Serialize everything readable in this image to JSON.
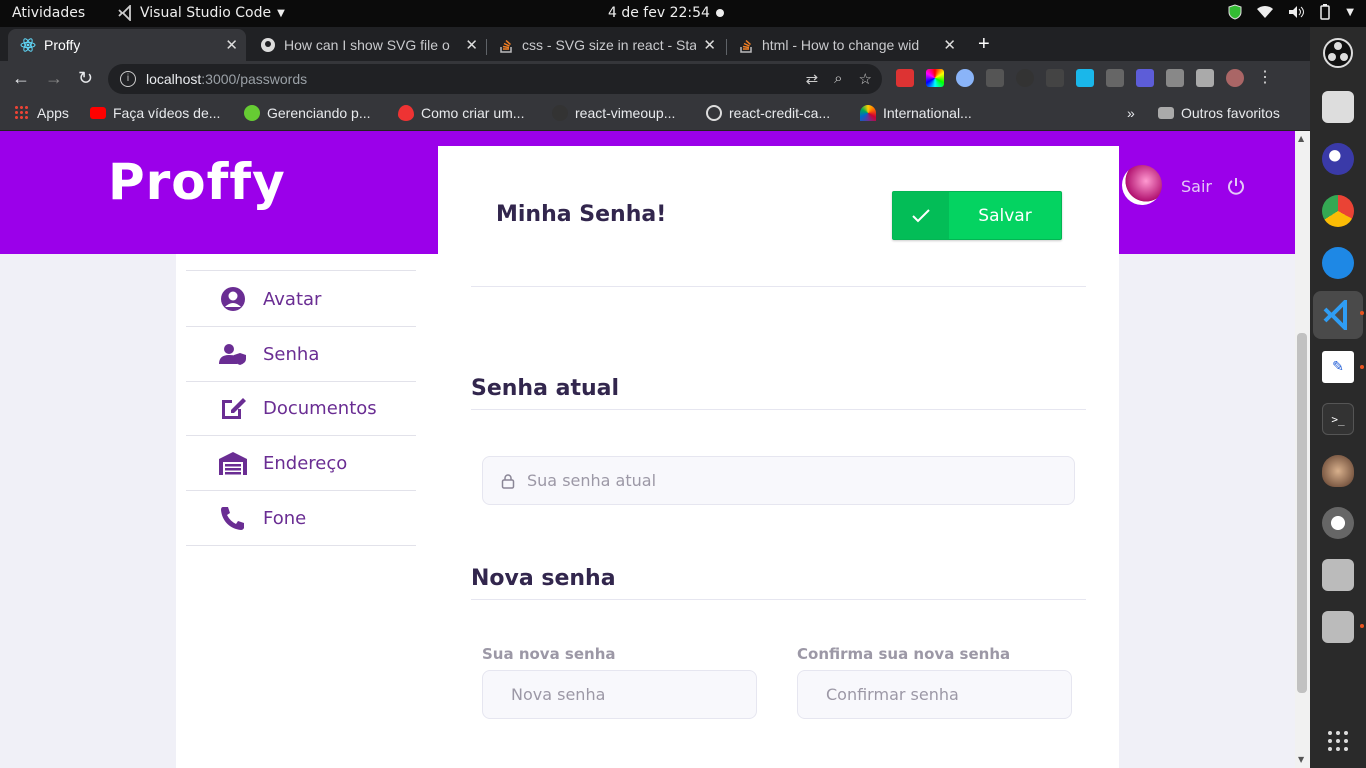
{
  "topbar": {
    "activities": "Atividades",
    "app_name": "Visual Studio Code",
    "clock": "4 de fev  22:54"
  },
  "browser": {
    "tabs": [
      {
        "title": "Proffy",
        "icon": "react-icon",
        "active": true
      },
      {
        "title": "How can I show SVG file o",
        "icon": "github-icon",
        "active": false
      },
      {
        "title": "css - SVG size in react - Sta",
        "icon": "stackoverflow-icon",
        "active": false
      },
      {
        "title": "html - How to change wid",
        "icon": "stackoverflow-icon",
        "active": false
      }
    ],
    "url_host": "localhost",
    "url_path": ":3000/passwords",
    "bookmarks": [
      {
        "label": "Apps",
        "icon": "apps-grid-icon"
      },
      {
        "label": "Faça vídeos de...",
        "icon": "youtube-icon"
      },
      {
        "label": "Gerenciando p...",
        "icon": "leaf-icon"
      },
      {
        "label": "Como criar um...",
        "icon": "flame-icon"
      },
      {
        "label": "react-vimeoup...",
        "icon": "github-icon"
      },
      {
        "label": "react-credit-ca...",
        "icon": "globe-icon"
      },
      {
        "label": "International...",
        "icon": "nbc-icon"
      }
    ],
    "more_bookmarks": "»",
    "other_favorites": "Outros favoritos"
  },
  "app": {
    "logo": "Proffy",
    "logout_label": "Sair",
    "sidebar": [
      {
        "label": "Avatar",
        "icon": "user-circle-icon"
      },
      {
        "label": "Senha",
        "icon": "user-shield-icon"
      },
      {
        "label": "Documentos",
        "icon": "edit-icon"
      },
      {
        "label": "Endereço",
        "icon": "warehouse-icon"
      },
      {
        "label": "Fone",
        "icon": "phone-icon"
      }
    ],
    "page_title": "Minha Senha!",
    "save_label": "Salvar",
    "current_section": "Senha atual",
    "current_placeholder": "Sua senha atual",
    "new_section": "Nova senha",
    "new_label": "Sua nova senha",
    "new_placeholder": "Nova senha",
    "confirm_label": "Confirma sua nova senha",
    "confirm_placeholder": "Confirmar senha"
  },
  "colors": {
    "brand_purple": "#9b00ea",
    "save_green": "#04d361",
    "menu_text": "#6a2d93"
  }
}
